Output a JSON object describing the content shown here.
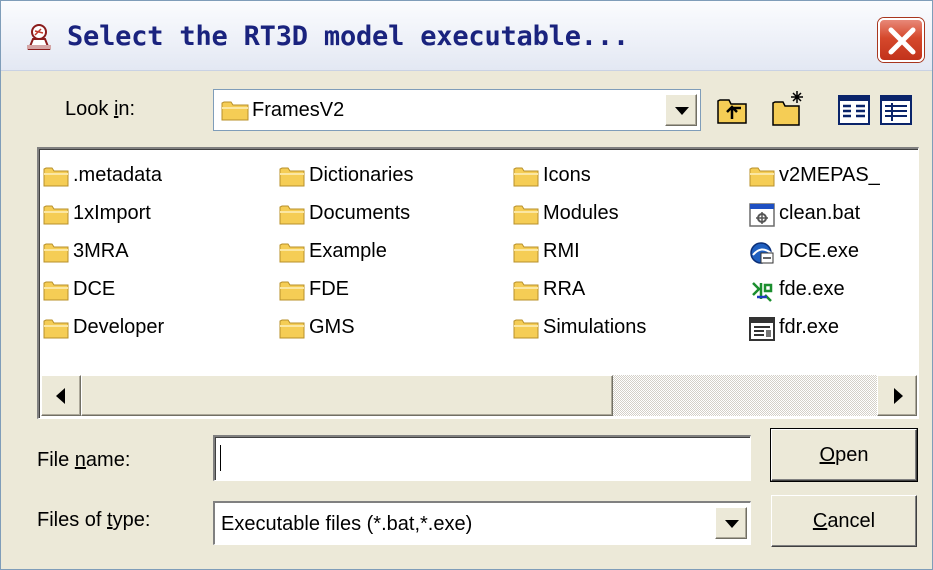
{
  "window": {
    "title": "Select the RT3D model executable...",
    "icon": "app-icon",
    "close_icon": "close-icon"
  },
  "look_in": {
    "label_pre": "Look ",
    "label_key": "i",
    "label_post": "n:",
    "value": "FramesV2"
  },
  "toolbar": {
    "up_folder_icon": "up-one-level-icon",
    "new_folder_icon": "create-new-folder-icon",
    "list_view_icon": "list-view-icon",
    "details_view_icon": "details-view-icon"
  },
  "files": {
    "col1": [
      {
        "name": ".metadata",
        "icon": "folder-icon"
      },
      {
        "name": "1xImport",
        "icon": "folder-icon"
      },
      {
        "name": "3MRA",
        "icon": "folder-icon"
      },
      {
        "name": "DCE",
        "icon": "folder-icon"
      },
      {
        "name": "Developer",
        "icon": "folder-icon"
      }
    ],
    "col2": [
      {
        "name": "Dictionaries",
        "icon": "folder-icon"
      },
      {
        "name": "Documents",
        "icon": "folder-icon"
      },
      {
        "name": "Example",
        "icon": "folder-icon"
      },
      {
        "name": "FDE",
        "icon": "folder-icon"
      },
      {
        "name": "GMS",
        "icon": "folder-icon"
      }
    ],
    "col3": [
      {
        "name": "Icons",
        "icon": "folder-icon"
      },
      {
        "name": "Modules",
        "icon": "folder-icon"
      },
      {
        "name": "RMI",
        "icon": "folder-icon"
      },
      {
        "name": "RRA",
        "icon": "folder-icon"
      },
      {
        "name": "Simulations",
        "icon": "folder-icon"
      }
    ],
    "col4": [
      {
        "name": "v2MEPAS_",
        "icon": "folder-icon"
      },
      {
        "name": "clean.bat",
        "icon": "batch-file-icon"
      },
      {
        "name": "DCE.exe",
        "icon": "dce-exe-icon"
      },
      {
        "name": "fde.exe",
        "icon": "fde-exe-icon"
      },
      {
        "name": "fdr.exe",
        "icon": "fdr-exe-icon"
      }
    ]
  },
  "scrollbar": {
    "left_icon": "scroll-left-arrow-icon",
    "right_icon": "scroll-right-arrow-icon"
  },
  "file_name": {
    "label_pre": "File ",
    "label_key": "n",
    "label_post": "ame:",
    "value": ""
  },
  "file_type": {
    "label_pre": "Files of ",
    "label_key": "t",
    "label_post": "ype:",
    "value": "Executable files (*.bat,*.exe)"
  },
  "buttons": {
    "open_key": "O",
    "open_rest": "pen",
    "cancel_key": "C",
    "cancel_rest": "ancel"
  },
  "colors": {
    "dialog_bg": "#ece9d8",
    "title_text": "#1a237e",
    "close_red": "#d5482c",
    "folder_yellow": "#f5cd55"
  }
}
